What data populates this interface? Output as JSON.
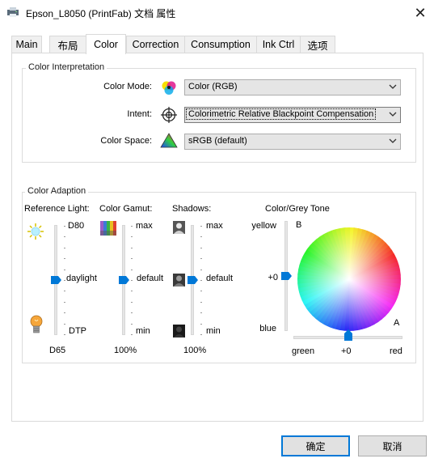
{
  "window": {
    "title": "Epson_L8050 (PrintFab) 文档 属性",
    "close_glyph": "✕"
  },
  "tabs": [
    "Main",
    "布局",
    "Color",
    "Correction",
    "Consumption",
    "Ink Ctrl",
    "选项"
  ],
  "active_tab": "Color",
  "color_interpretation": {
    "title": "Color Interpretation",
    "color_mode": {
      "label": "Color Mode:",
      "value": "Color (RGB)",
      "icon": "cmy-circles-icon"
    },
    "intent": {
      "label": "Intent:",
      "value": "Colorimetric Relative Blackpoint Compensation",
      "icon": "crosshair-target-icon"
    },
    "color_space": {
      "label": "Color Space:",
      "value": "sRGB (default)",
      "icon": "color-gamut-triangle-icon"
    }
  },
  "color_adaption": {
    "title": "Color Adaption",
    "reference_light": {
      "label": "Reference Light:",
      "top": "D80",
      "middle": "daylight",
      "bottom": "DTP",
      "value": "D65",
      "level": 0.5
    },
    "color_gamut": {
      "label": "Color Gamut:",
      "top": "max",
      "middle": "default",
      "bottom": "min",
      "value": "100%",
      "level": 0.5
    },
    "shadows": {
      "label": "Shadows:",
      "top": "max",
      "middle": "default",
      "bottom": "min",
      "value": "100%",
      "level": 0.5
    },
    "tone": {
      "label": "Color/Grey Tone",
      "top": "yellow",
      "middle": "+0",
      "bottom": "blue",
      "b_label": "B",
      "a_label": "A",
      "h_left": "green",
      "h_value": "+0",
      "h_right": "red",
      "level": 0.5,
      "h_level": 0.5
    }
  },
  "buttons": {
    "ok": "确定",
    "cancel": "取消"
  }
}
